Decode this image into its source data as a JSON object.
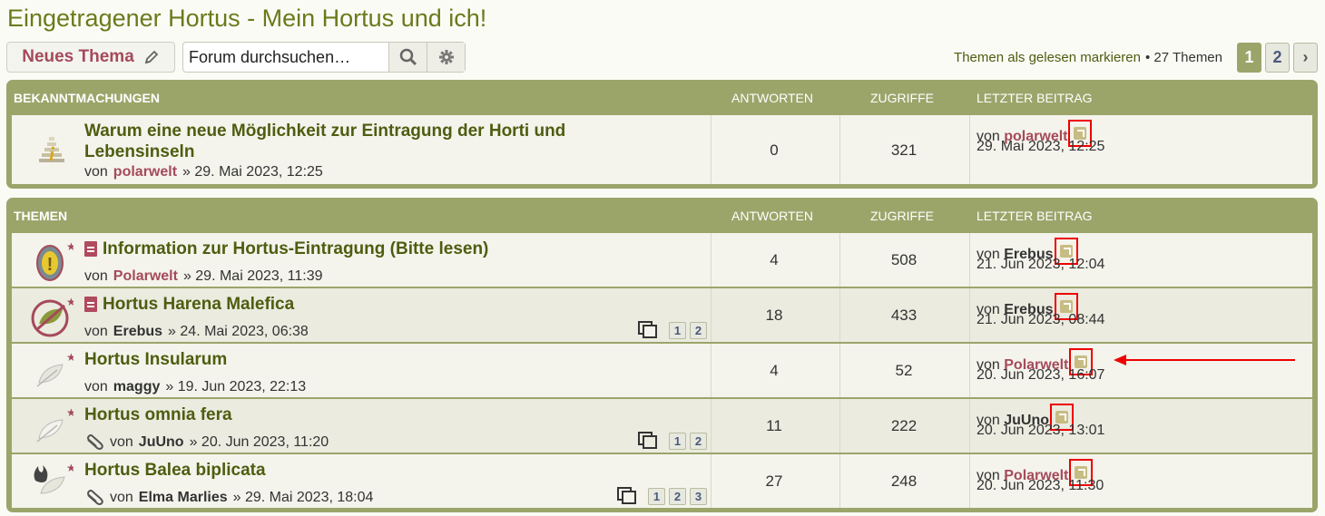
{
  "page": {
    "title": "Eingetragener Hortus - Mein Hortus und ich!"
  },
  "toolbar": {
    "new_topic_label": "Neues Thema",
    "search_placeholder": "Forum durchsuchen…",
    "mark_read_label": "Themen als gelesen markieren",
    "topic_count": "• 27 Themen",
    "pages": [
      "1",
      "2"
    ],
    "next_label": "›"
  },
  "announcements": {
    "header": {
      "title": "BEKANNTMACHUNGEN",
      "replies": "ANTWORTEN",
      "views": "ZUGRIFFE",
      "last_post": "LETZTER BEITRAG"
    },
    "rows": [
      {
        "title": "Warum eine neue Möglichkeit zur Eintragung der Horti und Lebensinseln",
        "by": "von",
        "author": "polarwelt",
        "date": "» 29. Mai 2023, 12:25",
        "replies": "0",
        "views": "321",
        "last_by": "von",
        "last_author": "polarwelt",
        "last_date": "29. Mai 2023, 12:25"
      }
    ]
  },
  "topics": {
    "header": {
      "title": "THEMEN",
      "replies": "ANTWORTEN",
      "views": "ZUGRIFFE",
      "last_post": "LETZTER BEITRAG"
    },
    "rows": [
      {
        "title": "Information zur Hortus-Eintragung (Bitte lesen)",
        "by": "von",
        "author": "Polarwelt",
        "date": "» 29. Mai 2023, 11:39",
        "replies": "4",
        "views": "508",
        "last_by": "von",
        "last_author": "Erebus",
        "last_date": "21. Jun 2023, 12:04"
      },
      {
        "title": "Hortus Harena Malefica",
        "by": "von",
        "author": "Erebus",
        "date": "» 24. Mai 2023, 06:38",
        "replies": "18",
        "views": "433",
        "last_by": "von",
        "last_author": "Erebus",
        "last_date": "21. Jun 2023, 08:44",
        "pages": [
          "1",
          "2"
        ]
      },
      {
        "title": "Hortus Insularum",
        "by": "von",
        "author": "maggy",
        "date": "» 19. Jun 2023, 22:13",
        "replies": "4",
        "views": "52",
        "last_by": "von",
        "last_author": "Polarwelt",
        "last_date": "20. Jun 2023, 16:07"
      },
      {
        "title": "Hortus omnia fera",
        "by": "von",
        "author": "JuUno",
        "date": "» 20. Jun 2023, 11:20",
        "replies": "11",
        "views": "222",
        "last_by": "von",
        "last_author": "JuUno",
        "last_date": "20. Jun 2023, 13:01",
        "pages": [
          "1",
          "2"
        ]
      },
      {
        "title": "Hortus Balea biplicata",
        "by": "von",
        "author": "Elma Marlies",
        "date": "» 29. Mai 2023, 18:04",
        "replies": "27",
        "views": "248",
        "last_by": "von",
        "last_author": "Polarwelt",
        "last_date": "20. Jun 2023, 11:30",
        "pages": [
          "1",
          "2",
          "3"
        ]
      }
    ]
  },
  "colors": {
    "accent": "#9ba56a",
    "title": "#4e5d10",
    "author_red": "#a54a5a",
    "highlight": "#e00000"
  }
}
